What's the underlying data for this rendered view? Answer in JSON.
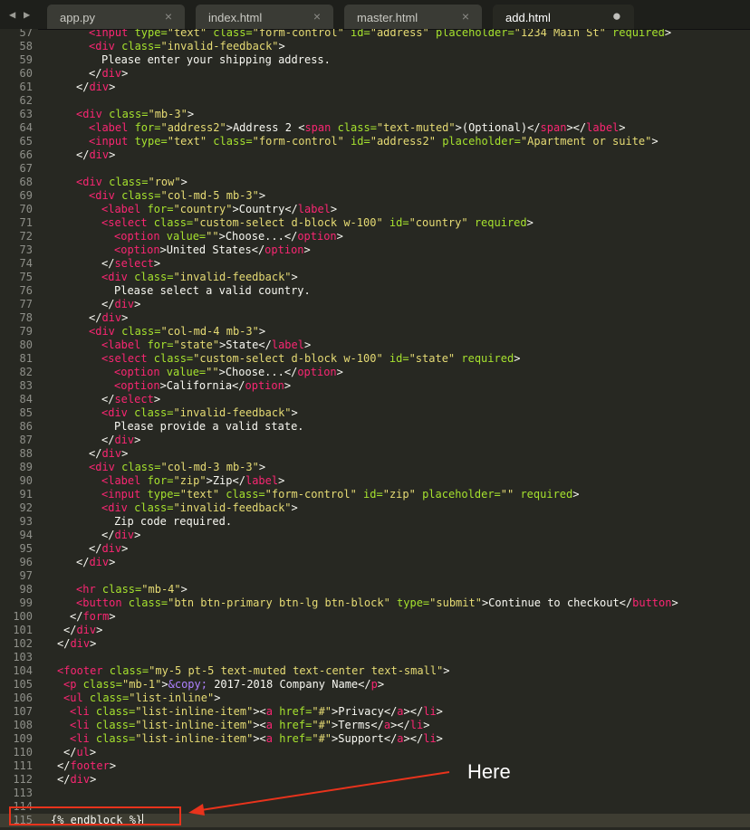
{
  "tabs": [
    {
      "label": "app.py",
      "close": "×",
      "active": false
    },
    {
      "label": "index.html",
      "close": "×",
      "active": false
    },
    {
      "label": "master.html",
      "close": "×",
      "active": false
    },
    {
      "label": "add.html",
      "close": "●",
      "active": true
    }
  ],
  "nav": {
    "left": "◀",
    "right": "▶"
  },
  "annotation": {
    "text": "Here"
  },
  "colors": {
    "background": "#272822",
    "tag": "#f92672",
    "attr": "#a6e22e",
    "string": "#e6db74",
    "annotation": "#e8331c"
  },
  "lines": [
    {
      "n": "57",
      "indent": 6,
      "segs": [
        [
          "t",
          "<input"
        ],
        [
          "a",
          " type="
        ],
        [
          "s",
          "\"text\""
        ],
        [
          "a",
          " class="
        ],
        [
          "s",
          "\"form-control\""
        ],
        [
          "a",
          " id="
        ],
        [
          "s",
          "\"address\""
        ],
        [
          "a",
          " placeholder="
        ],
        [
          "s",
          "\"1234 Main St\""
        ],
        [
          "a",
          " required"
        ],
        [
          "txt",
          ">"
        ]
      ]
    },
    {
      "n": "58",
      "indent": 6,
      "segs": [
        [
          "t",
          "<div"
        ],
        [
          "a",
          " class="
        ],
        [
          "s",
          "\"invalid-feedback\""
        ],
        [
          "txt",
          ">"
        ]
      ]
    },
    {
      "n": "59",
      "indent": 8,
      "segs": [
        [
          "txt",
          "Please enter your shipping address."
        ]
      ]
    },
    {
      "n": "60",
      "indent": 6,
      "segs": [
        [
          "txt",
          "</"
        ],
        [
          "t",
          "div"
        ],
        [
          "txt",
          ">"
        ]
      ]
    },
    {
      "n": "61",
      "indent": 4,
      "segs": [
        [
          "txt",
          "</"
        ],
        [
          "t",
          "div"
        ],
        [
          "txt",
          ">"
        ]
      ]
    },
    {
      "n": "62",
      "indent": 0,
      "segs": []
    },
    {
      "n": "63",
      "indent": 4,
      "segs": [
        [
          "t",
          "<div"
        ],
        [
          "a",
          " class="
        ],
        [
          "s",
          "\"mb-3\""
        ],
        [
          "txt",
          ">"
        ]
      ]
    },
    {
      "n": "64",
      "indent": 6,
      "segs": [
        [
          "t",
          "<label"
        ],
        [
          "a",
          " for="
        ],
        [
          "s",
          "\"address2\""
        ],
        [
          "txt",
          ">Address 2 <"
        ],
        [
          "t",
          "span"
        ],
        [
          "a",
          " class="
        ],
        [
          "s",
          "\"text-muted\""
        ],
        [
          "txt",
          ">(Optional)</"
        ],
        [
          "t",
          "span"
        ],
        [
          "txt",
          "></"
        ],
        [
          "t",
          "label"
        ],
        [
          "txt",
          ">"
        ]
      ]
    },
    {
      "n": "65",
      "indent": 6,
      "segs": [
        [
          "t",
          "<input"
        ],
        [
          "a",
          " type="
        ],
        [
          "s",
          "\"text\""
        ],
        [
          "a",
          " class="
        ],
        [
          "s",
          "\"form-control\""
        ],
        [
          "a",
          " id="
        ],
        [
          "s",
          "\"address2\""
        ],
        [
          "a",
          " placeholder="
        ],
        [
          "s",
          "\"Apartment or suite\""
        ],
        [
          "txt",
          ">"
        ]
      ]
    },
    {
      "n": "66",
      "indent": 4,
      "segs": [
        [
          "txt",
          "</"
        ],
        [
          "t",
          "div"
        ],
        [
          "txt",
          ">"
        ]
      ]
    },
    {
      "n": "67",
      "indent": 0,
      "segs": []
    },
    {
      "n": "68",
      "indent": 4,
      "segs": [
        [
          "t",
          "<div"
        ],
        [
          "a",
          " class="
        ],
        [
          "s",
          "\"row\""
        ],
        [
          "txt",
          ">"
        ]
      ]
    },
    {
      "n": "69",
      "indent": 6,
      "segs": [
        [
          "t",
          "<div"
        ],
        [
          "a",
          " class="
        ],
        [
          "s",
          "\"col-md-5 mb-3\""
        ],
        [
          "txt",
          ">"
        ]
      ]
    },
    {
      "n": "70",
      "indent": 8,
      "segs": [
        [
          "t",
          "<label"
        ],
        [
          "a",
          " for="
        ],
        [
          "s",
          "\"country\""
        ],
        [
          "txt",
          ">Country</"
        ],
        [
          "t",
          "label"
        ],
        [
          "txt",
          ">"
        ]
      ]
    },
    {
      "n": "71",
      "indent": 8,
      "segs": [
        [
          "t",
          "<select"
        ],
        [
          "a",
          " class="
        ],
        [
          "s",
          "\"custom-select d-block w-100\""
        ],
        [
          "a",
          " id="
        ],
        [
          "s",
          "\"country\""
        ],
        [
          "a",
          " required"
        ],
        [
          "txt",
          ">"
        ]
      ]
    },
    {
      "n": "72",
      "indent": 10,
      "segs": [
        [
          "t",
          "<option"
        ],
        [
          "a",
          " value="
        ],
        [
          "s",
          "\"\""
        ],
        [
          "txt",
          ">Choose...</"
        ],
        [
          "t",
          "option"
        ],
        [
          "txt",
          ">"
        ]
      ]
    },
    {
      "n": "73",
      "indent": 10,
      "segs": [
        [
          "t",
          "<option"
        ],
        [
          "txt",
          ">United States</"
        ],
        [
          "t",
          "option"
        ],
        [
          "txt",
          ">"
        ]
      ]
    },
    {
      "n": "74",
      "indent": 8,
      "segs": [
        [
          "txt",
          "</"
        ],
        [
          "t",
          "select"
        ],
        [
          "txt",
          ">"
        ]
      ]
    },
    {
      "n": "75",
      "indent": 8,
      "segs": [
        [
          "t",
          "<div"
        ],
        [
          "a",
          " class="
        ],
        [
          "s",
          "\"invalid-feedback\""
        ],
        [
          "txt",
          ">"
        ]
      ]
    },
    {
      "n": "76",
      "indent": 10,
      "segs": [
        [
          "txt",
          "Please select a valid country."
        ]
      ]
    },
    {
      "n": "77",
      "indent": 8,
      "segs": [
        [
          "txt",
          "</"
        ],
        [
          "t",
          "div"
        ],
        [
          "txt",
          ">"
        ]
      ]
    },
    {
      "n": "78",
      "indent": 6,
      "segs": [
        [
          "txt",
          "</"
        ],
        [
          "t",
          "div"
        ],
        [
          "txt",
          ">"
        ]
      ]
    },
    {
      "n": "79",
      "indent": 6,
      "segs": [
        [
          "t",
          "<div"
        ],
        [
          "a",
          " class="
        ],
        [
          "s",
          "\"col-md-4 mb-3\""
        ],
        [
          "txt",
          ">"
        ]
      ]
    },
    {
      "n": "80",
      "indent": 8,
      "segs": [
        [
          "t",
          "<label"
        ],
        [
          "a",
          " for="
        ],
        [
          "s",
          "\"state\""
        ],
        [
          "txt",
          ">State</"
        ],
        [
          "t",
          "label"
        ],
        [
          "txt",
          ">"
        ]
      ]
    },
    {
      "n": "81",
      "indent": 8,
      "segs": [
        [
          "t",
          "<select"
        ],
        [
          "a",
          " class="
        ],
        [
          "s",
          "\"custom-select d-block w-100\""
        ],
        [
          "a",
          " id="
        ],
        [
          "s",
          "\"state\""
        ],
        [
          "a",
          " required"
        ],
        [
          "txt",
          ">"
        ]
      ]
    },
    {
      "n": "82",
      "indent": 10,
      "segs": [
        [
          "t",
          "<option"
        ],
        [
          "a",
          " value="
        ],
        [
          "s",
          "\"\""
        ],
        [
          "txt",
          ">Choose...</"
        ],
        [
          "t",
          "option"
        ],
        [
          "txt",
          ">"
        ]
      ]
    },
    {
      "n": "83",
      "indent": 10,
      "segs": [
        [
          "t",
          "<option"
        ],
        [
          "txt",
          ">California</"
        ],
        [
          "t",
          "option"
        ],
        [
          "txt",
          ">"
        ]
      ]
    },
    {
      "n": "84",
      "indent": 8,
      "segs": [
        [
          "txt",
          "</"
        ],
        [
          "t",
          "select"
        ],
        [
          "txt",
          ">"
        ]
      ]
    },
    {
      "n": "85",
      "indent": 8,
      "segs": [
        [
          "t",
          "<div"
        ],
        [
          "a",
          " class="
        ],
        [
          "s",
          "\"invalid-feedback\""
        ],
        [
          "txt",
          ">"
        ]
      ]
    },
    {
      "n": "86",
      "indent": 10,
      "segs": [
        [
          "txt",
          "Please provide a valid state."
        ]
      ]
    },
    {
      "n": "87",
      "indent": 8,
      "segs": [
        [
          "txt",
          "</"
        ],
        [
          "t",
          "div"
        ],
        [
          "txt",
          ">"
        ]
      ]
    },
    {
      "n": "88",
      "indent": 6,
      "segs": [
        [
          "txt",
          "</"
        ],
        [
          "t",
          "div"
        ],
        [
          "txt",
          ">"
        ]
      ]
    },
    {
      "n": "89",
      "indent": 6,
      "segs": [
        [
          "t",
          "<div"
        ],
        [
          "a",
          " class="
        ],
        [
          "s",
          "\"col-md-3 mb-3\""
        ],
        [
          "txt",
          ">"
        ]
      ]
    },
    {
      "n": "90",
      "indent": 8,
      "segs": [
        [
          "t",
          "<label"
        ],
        [
          "a",
          " for="
        ],
        [
          "s",
          "\"zip\""
        ],
        [
          "txt",
          ">Zip</"
        ],
        [
          "t",
          "label"
        ],
        [
          "txt",
          ">"
        ]
      ]
    },
    {
      "n": "91",
      "indent": 8,
      "segs": [
        [
          "t",
          "<input"
        ],
        [
          "a",
          " type="
        ],
        [
          "s",
          "\"text\""
        ],
        [
          "a",
          " class="
        ],
        [
          "s",
          "\"form-control\""
        ],
        [
          "a",
          " id="
        ],
        [
          "s",
          "\"zip\""
        ],
        [
          "a",
          " placeholder="
        ],
        [
          "s",
          "\"\""
        ],
        [
          "a",
          " required"
        ],
        [
          "txt",
          ">"
        ]
      ]
    },
    {
      "n": "92",
      "indent": 8,
      "segs": [
        [
          "t",
          "<div"
        ],
        [
          "a",
          " class="
        ],
        [
          "s",
          "\"invalid-feedback\""
        ],
        [
          "txt",
          ">"
        ]
      ]
    },
    {
      "n": "93",
      "indent": 10,
      "segs": [
        [
          "txt",
          "Zip code required."
        ]
      ]
    },
    {
      "n": "94",
      "indent": 8,
      "segs": [
        [
          "txt",
          "</"
        ],
        [
          "t",
          "div"
        ],
        [
          "txt",
          ">"
        ]
      ]
    },
    {
      "n": "95",
      "indent": 6,
      "segs": [
        [
          "txt",
          "</"
        ],
        [
          "t",
          "div"
        ],
        [
          "txt",
          ">"
        ]
      ]
    },
    {
      "n": "96",
      "indent": 4,
      "segs": [
        [
          "txt",
          "</"
        ],
        [
          "t",
          "div"
        ],
        [
          "txt",
          ">"
        ]
      ]
    },
    {
      "n": "97",
      "indent": 0,
      "segs": []
    },
    {
      "n": "98",
      "indent": 4,
      "segs": [
        [
          "t",
          "<hr"
        ],
        [
          "a",
          " class="
        ],
        [
          "s",
          "\"mb-4\""
        ],
        [
          "txt",
          ">"
        ]
      ]
    },
    {
      "n": "99",
      "indent": 4,
      "segs": [
        [
          "t",
          "<button"
        ],
        [
          "a",
          " class="
        ],
        [
          "s",
          "\"btn btn-primary btn-lg btn-block\""
        ],
        [
          "a",
          " type="
        ],
        [
          "s",
          "\"submit\""
        ],
        [
          "txt",
          ">Continue to checkout</"
        ],
        [
          "t",
          "button"
        ],
        [
          "txt",
          ">"
        ]
      ]
    },
    {
      "n": "100",
      "indent": 3,
      "segs": [
        [
          "txt",
          "</"
        ],
        [
          "t",
          "form"
        ],
        [
          "txt",
          ">"
        ]
      ]
    },
    {
      "n": "101",
      "indent": 2,
      "segs": [
        [
          "txt",
          "</"
        ],
        [
          "t",
          "div"
        ],
        [
          "txt",
          ">"
        ]
      ]
    },
    {
      "n": "102",
      "indent": 1,
      "segs": [
        [
          "txt",
          "</"
        ],
        [
          "t",
          "div"
        ],
        [
          "txt",
          ">"
        ]
      ]
    },
    {
      "n": "103",
      "indent": 0,
      "segs": []
    },
    {
      "n": "104",
      "indent": 1,
      "segs": [
        [
          "t",
          "<footer"
        ],
        [
          "a",
          " class="
        ],
        [
          "s",
          "\"my-5 pt-5 text-muted text-center text-small\""
        ],
        [
          "txt",
          ">"
        ]
      ]
    },
    {
      "n": "105",
      "indent": 2,
      "segs": [
        [
          "t",
          "<p"
        ],
        [
          "a",
          " class="
        ],
        [
          "s",
          "\"mb-1\""
        ],
        [
          "txt",
          ">"
        ],
        [
          "e",
          "&copy;"
        ],
        [
          "txt",
          " 2017-2018 Company Name</"
        ],
        [
          "t",
          "p"
        ],
        [
          "txt",
          ">"
        ]
      ]
    },
    {
      "n": "106",
      "indent": 2,
      "segs": [
        [
          "t",
          "<ul"
        ],
        [
          "a",
          " class="
        ],
        [
          "s",
          "\"list-inline\""
        ],
        [
          "txt",
          ">"
        ]
      ]
    },
    {
      "n": "107",
      "indent": 3,
      "segs": [
        [
          "t",
          "<li"
        ],
        [
          "a",
          " class="
        ],
        [
          "s",
          "\"list-inline-item\""
        ],
        [
          "txt",
          "><"
        ],
        [
          "t",
          "a"
        ],
        [
          "a",
          " href="
        ],
        [
          "s",
          "\"#\""
        ],
        [
          "txt",
          ">Privacy</"
        ],
        [
          "t",
          "a"
        ],
        [
          "txt",
          "></"
        ],
        [
          "t",
          "li"
        ],
        [
          "txt",
          ">"
        ]
      ]
    },
    {
      "n": "108",
      "indent": 3,
      "segs": [
        [
          "t",
          "<li"
        ],
        [
          "a",
          " class="
        ],
        [
          "s",
          "\"list-inline-item\""
        ],
        [
          "txt",
          "><"
        ],
        [
          "t",
          "a"
        ],
        [
          "a",
          " href="
        ],
        [
          "s",
          "\"#\""
        ],
        [
          "txt",
          ">Terms</"
        ],
        [
          "t",
          "a"
        ],
        [
          "txt",
          "></"
        ],
        [
          "t",
          "li"
        ],
        [
          "txt",
          ">"
        ]
      ]
    },
    {
      "n": "109",
      "indent": 3,
      "segs": [
        [
          "t",
          "<li"
        ],
        [
          "a",
          " class="
        ],
        [
          "s",
          "\"list-inline-item\""
        ],
        [
          "txt",
          "><"
        ],
        [
          "t",
          "a"
        ],
        [
          "a",
          " href="
        ],
        [
          "s",
          "\"#\""
        ],
        [
          "txt",
          ">Support</"
        ],
        [
          "t",
          "a"
        ],
        [
          "txt",
          "></"
        ],
        [
          "t",
          "li"
        ],
        [
          "txt",
          ">"
        ]
      ]
    },
    {
      "n": "110",
      "indent": 2,
      "segs": [
        [
          "txt",
          "</"
        ],
        [
          "t",
          "ul"
        ],
        [
          "txt",
          ">"
        ]
      ]
    },
    {
      "n": "111",
      "indent": 1,
      "segs": [
        [
          "txt",
          "</"
        ],
        [
          "t",
          "footer"
        ],
        [
          "txt",
          ">"
        ]
      ]
    },
    {
      "n": "112",
      "indent": 1,
      "segs": [
        [
          "txt",
          "</"
        ],
        [
          "t",
          "div"
        ],
        [
          "txt",
          ">"
        ]
      ]
    },
    {
      "n": "113",
      "indent": 0,
      "segs": []
    },
    {
      "n": "114",
      "indent": 0,
      "segs": []
    },
    {
      "n": "115",
      "indent": 0,
      "segs": [
        [
          "txt",
          "{% endblock %}"
        ]
      ],
      "current": true
    }
  ]
}
